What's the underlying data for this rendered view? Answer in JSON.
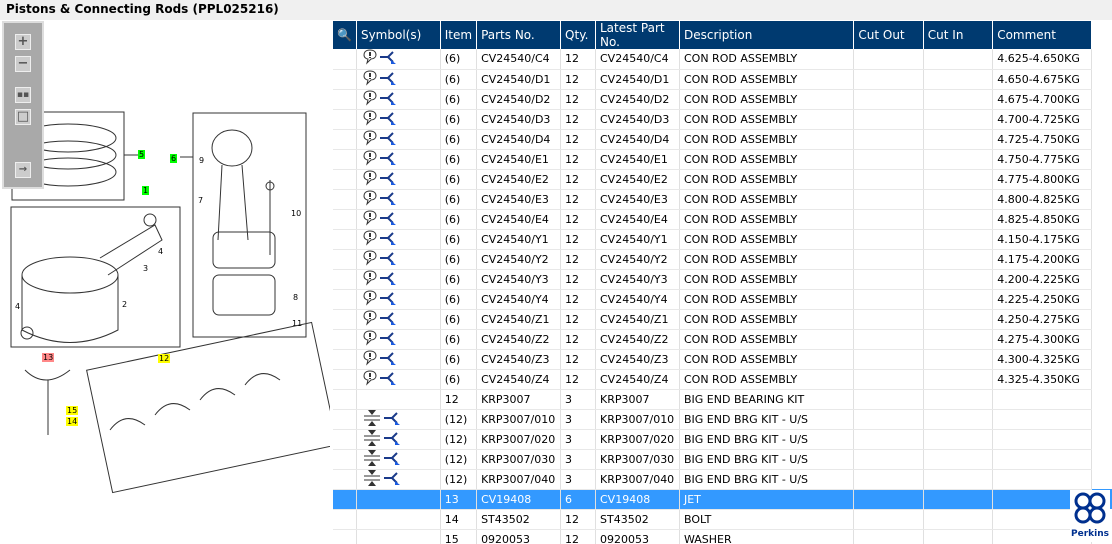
{
  "title": "Pistons & Connecting Rods (PPL025216)",
  "toolbar": {
    "zoom_in": "zoom-in",
    "zoom_out": "zoom-out",
    "fit": "fit",
    "actual": "actual-size",
    "export": "export"
  },
  "diagram_labels": {
    "l5": "5",
    "l6": "6",
    "l1": "1",
    "l13": "13",
    "l12": "12",
    "l15": "15",
    "l14": "14",
    "n9": "9",
    "n7": "7",
    "n10": "10",
    "n8": "8",
    "n11": "11",
    "n3": "3",
    "n4a": "4",
    "n4b": "4",
    "n2": "2"
  },
  "columns": [
    "Symbol(s)",
    "Item",
    "Parts No.",
    "Qty.",
    "Latest Part No.",
    "Description",
    "Cut Out",
    "Cut In",
    "Comment"
  ],
  "rows": [
    {
      "sym": "note",
      "item": "(6)",
      "part": "CV24540/C4",
      "qty": "12",
      "latest": "CV24540/C4",
      "desc": "CON ROD ASSEMBLY",
      "cutout": "",
      "cutin": "",
      "comment": "4.625-4.650KG"
    },
    {
      "sym": "note",
      "item": "(6)",
      "part": "CV24540/D1",
      "qty": "12",
      "latest": "CV24540/D1",
      "desc": "CON ROD ASSEMBLY",
      "cutout": "",
      "cutin": "",
      "comment": "4.650-4.675KG"
    },
    {
      "sym": "note",
      "item": "(6)",
      "part": "CV24540/D2",
      "qty": "12",
      "latest": "CV24540/D2",
      "desc": "CON ROD ASSEMBLY",
      "cutout": "",
      "cutin": "",
      "comment": "4.675-4.700KG"
    },
    {
      "sym": "note",
      "item": "(6)",
      "part": "CV24540/D3",
      "qty": "12",
      "latest": "CV24540/D3",
      "desc": "CON ROD ASSEMBLY",
      "cutout": "",
      "cutin": "",
      "comment": "4.700-4.725KG"
    },
    {
      "sym": "note",
      "item": "(6)",
      "part": "CV24540/D4",
      "qty": "12",
      "latest": "CV24540/D4",
      "desc": "CON ROD ASSEMBLY",
      "cutout": "",
      "cutin": "",
      "comment": "4.725-4.750KG"
    },
    {
      "sym": "note",
      "item": "(6)",
      "part": "CV24540/E1",
      "qty": "12",
      "latest": "CV24540/E1",
      "desc": "CON ROD ASSEMBLY",
      "cutout": "",
      "cutin": "",
      "comment": "4.750-4.775KG"
    },
    {
      "sym": "note",
      "item": "(6)",
      "part": "CV24540/E2",
      "qty": "12",
      "latest": "CV24540/E2",
      "desc": "CON ROD ASSEMBLY",
      "cutout": "",
      "cutin": "",
      "comment": "4.775-4.800KG"
    },
    {
      "sym": "note",
      "item": "(6)",
      "part": "CV24540/E3",
      "qty": "12",
      "latest": "CV24540/E3",
      "desc": "CON ROD ASSEMBLY",
      "cutout": "",
      "cutin": "",
      "comment": "4.800-4.825KG"
    },
    {
      "sym": "note",
      "item": "(6)",
      "part": "CV24540/E4",
      "qty": "12",
      "latest": "CV24540/E4",
      "desc": "CON ROD ASSEMBLY",
      "cutout": "",
      "cutin": "",
      "comment": "4.825-4.850KG"
    },
    {
      "sym": "note",
      "item": "(6)",
      "part": "CV24540/Y1",
      "qty": "12",
      "latest": "CV24540/Y1",
      "desc": "CON ROD ASSEMBLY",
      "cutout": "",
      "cutin": "",
      "comment": "4.150-4.175KG"
    },
    {
      "sym": "note",
      "item": "(6)",
      "part": "CV24540/Y2",
      "qty": "12",
      "latest": "CV24540/Y2",
      "desc": "CON ROD ASSEMBLY",
      "cutout": "",
      "cutin": "",
      "comment": "4.175-4.200KG"
    },
    {
      "sym": "note",
      "item": "(6)",
      "part": "CV24540/Y3",
      "qty": "12",
      "latest": "CV24540/Y3",
      "desc": "CON ROD ASSEMBLY",
      "cutout": "",
      "cutin": "",
      "comment": "4.200-4.225KG"
    },
    {
      "sym": "note",
      "item": "(6)",
      "part": "CV24540/Y4",
      "qty": "12",
      "latest": "CV24540/Y4",
      "desc": "CON ROD ASSEMBLY",
      "cutout": "",
      "cutin": "",
      "comment": "4.225-4.250KG"
    },
    {
      "sym": "note",
      "item": "(6)",
      "part": "CV24540/Z1",
      "qty": "12",
      "latest": "CV24540/Z1",
      "desc": "CON ROD ASSEMBLY",
      "cutout": "",
      "cutin": "",
      "comment": "4.250-4.275KG"
    },
    {
      "sym": "note",
      "item": "(6)",
      "part": "CV24540/Z2",
      "qty": "12",
      "latest": "CV24540/Z2",
      "desc": "CON ROD ASSEMBLY",
      "cutout": "",
      "cutin": "",
      "comment": "4.275-4.300KG"
    },
    {
      "sym": "note",
      "item": "(6)",
      "part": "CV24540/Z3",
      "qty": "12",
      "latest": "CV24540/Z3",
      "desc": "CON ROD ASSEMBLY",
      "cutout": "",
      "cutin": "",
      "comment": "4.300-4.325KG"
    },
    {
      "sym": "note",
      "item": "(6)",
      "part": "CV24540/Z4",
      "qty": "12",
      "latest": "CV24540/Z4",
      "desc": "CON ROD ASSEMBLY",
      "cutout": "",
      "cutin": "",
      "comment": "4.325-4.350KG"
    },
    {
      "sym": "",
      "item": "12",
      "part": "KRP3007",
      "qty": "3",
      "latest": "KRP3007",
      "desc": "BIG END BEARING KIT",
      "cutout": "",
      "cutin": "",
      "comment": ""
    },
    {
      "sym": "undersize",
      "item": "(12)",
      "part": "KRP3007/010",
      "qty": "3",
      "latest": "KRP3007/010",
      "desc": "BIG END BRG KIT - U/S",
      "cutout": "",
      "cutin": "",
      "comment": ""
    },
    {
      "sym": "undersize",
      "item": "(12)",
      "part": "KRP3007/020",
      "qty": "3",
      "latest": "KRP3007/020",
      "desc": "BIG END BRG KIT - U/S",
      "cutout": "",
      "cutin": "",
      "comment": ""
    },
    {
      "sym": "undersize",
      "item": "(12)",
      "part": "KRP3007/030",
      "qty": "3",
      "latest": "KRP3007/030",
      "desc": "BIG END BRG KIT - U/S",
      "cutout": "",
      "cutin": "",
      "comment": ""
    },
    {
      "sym": "undersize",
      "item": "(12)",
      "part": "KRP3007/040",
      "qty": "3",
      "latest": "KRP3007/040",
      "desc": "BIG END BRG KIT - U/S",
      "cutout": "",
      "cutin": "",
      "comment": ""
    },
    {
      "sym": "",
      "item": "13",
      "part": "CV19408",
      "qty": "6",
      "latest": "CV19408",
      "desc": "JET",
      "cutout": "",
      "cutin": "",
      "comment": "",
      "selected": true
    },
    {
      "sym": "",
      "item": "14",
      "part": "ST43502",
      "qty": "12",
      "latest": "ST43502",
      "desc": "BOLT",
      "cutout": "",
      "cutin": "",
      "comment": ""
    },
    {
      "sym": "",
      "item": "15",
      "part": "0920053",
      "qty": "12",
      "latest": "0920053",
      "desc": "WASHER",
      "cutout": "",
      "cutin": "",
      "comment": ""
    }
  ],
  "logo": "Perkins",
  "colors": {
    "header": "#003a70",
    "selected": "#3399ff",
    "callout_green": "#00ff00",
    "callout_yellow": "#ffff00",
    "callout_red": "#ff8080"
  }
}
